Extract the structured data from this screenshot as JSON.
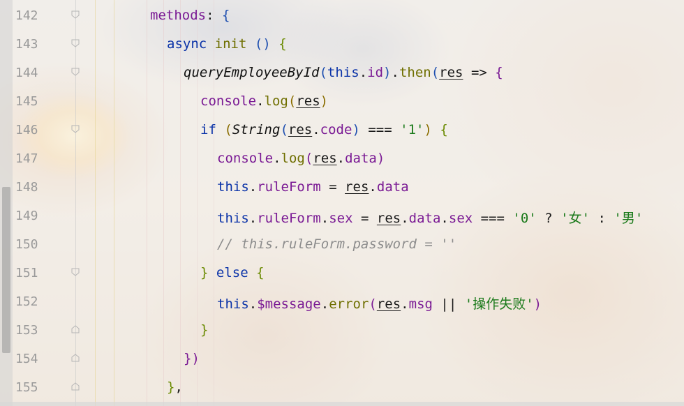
{
  "editor": {
    "lines": [
      {
        "num": "142",
        "tokens": [
          "methods",
          ":",
          " ",
          "{"
        ]
      },
      {
        "num": "143",
        "tokens": [
          "async",
          " ",
          "init",
          " ",
          "()",
          " ",
          "{"
        ]
      },
      {
        "num": "144",
        "tokens": [
          "queryEmployeeById",
          "(",
          "this",
          ".",
          "id",
          ")",
          ".",
          "then",
          "(",
          "res",
          " ",
          "=>",
          " ",
          "{"
        ]
      },
      {
        "num": "145",
        "tokens": [
          "console",
          ".",
          "log",
          "(",
          "res",
          ")"
        ]
      },
      {
        "num": "146",
        "tokens": [
          "if",
          " ",
          "(",
          "String",
          "(",
          "res",
          ".",
          "code",
          ")",
          " ",
          "===",
          " ",
          "'1'",
          ")",
          " ",
          "{"
        ]
      },
      {
        "num": "147",
        "tokens": [
          "console",
          ".",
          "log",
          "(",
          "res",
          ".",
          "data",
          ")"
        ]
      },
      {
        "num": "148",
        "tokens": [
          "this",
          ".",
          "ruleForm",
          " ",
          "=",
          " ",
          "res",
          ".",
          "data"
        ]
      },
      {
        "num": "149",
        "tokens": [
          "this",
          ".",
          "ruleForm",
          ".",
          "sex",
          " ",
          "=",
          " ",
          "res",
          ".",
          "data",
          ".",
          "sex",
          " ",
          "===",
          " ",
          "'0'",
          " ",
          "?",
          " ",
          "'女'",
          " ",
          ":",
          " ",
          "'男'"
        ]
      },
      {
        "num": "150",
        "tokens": [
          "// this.ruleForm.password = ''"
        ]
      },
      {
        "num": "151",
        "tokens": [
          "}",
          " ",
          "else",
          " ",
          "{"
        ]
      },
      {
        "num": "152",
        "tokens": [
          "this",
          ".",
          "$message",
          ".",
          "error",
          "(",
          "res",
          ".",
          "msg",
          " ",
          "||",
          " ",
          "'操作失败'",
          ")"
        ]
      },
      {
        "num": "153",
        "tokens": [
          "}"
        ]
      },
      {
        "num": "154",
        "tokens": [
          "})"
        ]
      },
      {
        "num": "155",
        "tokens": [
          "}",
          ","
        ]
      }
    ]
  },
  "icons": {
    "fold_marker": "fold-marker-icon"
  },
  "colors": {
    "keyword": "#0b33a8",
    "property": "#7a1a94",
    "string": "#1b7a1b",
    "comment": "#8c8c8c",
    "line_number": "#9a9a9a"
  }
}
